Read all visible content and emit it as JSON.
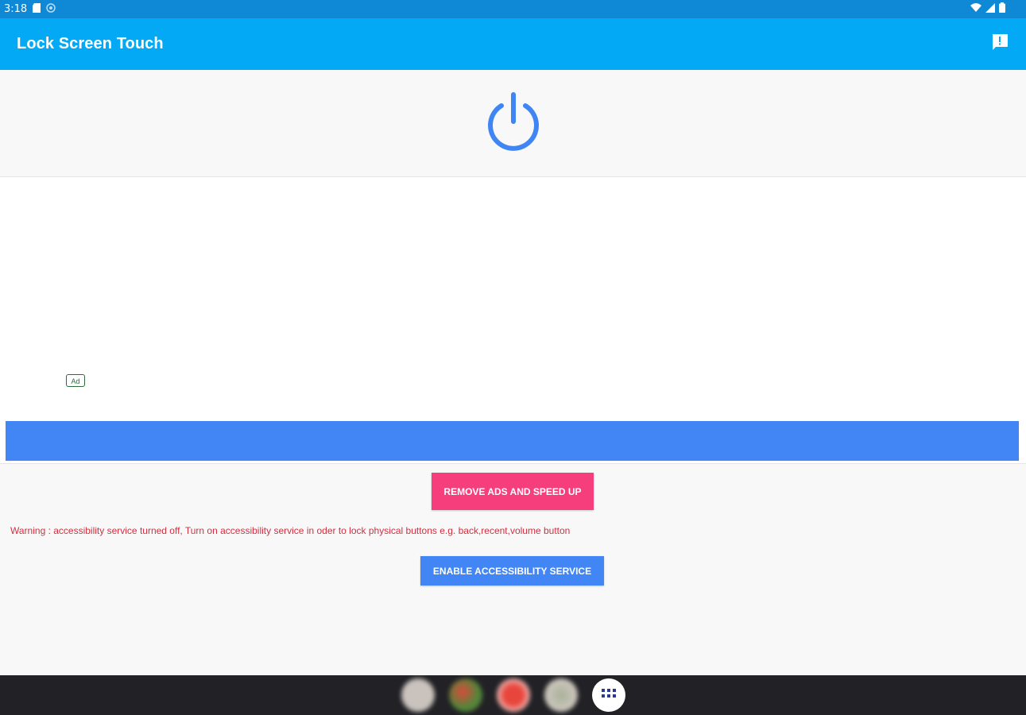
{
  "status_bar": {
    "time": "3:18",
    "left_icons": [
      "sd-card-icon",
      "location-icon"
    ],
    "right_icons": [
      "wifi-icon",
      "signal-icon",
      "battery-icon"
    ]
  },
  "app_bar": {
    "title": "Lock Screen Touch",
    "feedback_icon": "feedback-icon"
  },
  "power": {
    "icon": "power-icon",
    "color": "#3f86f4"
  },
  "ad": {
    "badge": "Ad",
    "cta_color": "#4285f4"
  },
  "actions": {
    "remove_ads_label": "REMOVE ADS AND SPEED UP",
    "warning": "Warning : accessibility service turned off, Turn on accessibility service in oder to lock physical buttons e.g. back,recent,volume  button",
    "enable_label": "ENABLE ACCESSIBILITY SERVICE"
  },
  "colors": {
    "status_bar": "#0f88d6",
    "app_bar": "#03a9f4",
    "remove_ads": "#f73e7d",
    "warning": "#d32f3f",
    "enable": "#4285f4",
    "nav_bar": "#222226"
  },
  "dock": {
    "apps": [
      {
        "name": "dock-app-1-icon",
        "color": "#c9c2bd"
      },
      {
        "name": "dock-app-2-icon",
        "color": "#7d6f3a"
      },
      {
        "name": "dock-app-3-icon",
        "color": "#e8453c"
      },
      {
        "name": "dock-app-4-icon",
        "color": "#b9b4ac"
      }
    ],
    "launcher_icon": "app-drawer-icon"
  }
}
